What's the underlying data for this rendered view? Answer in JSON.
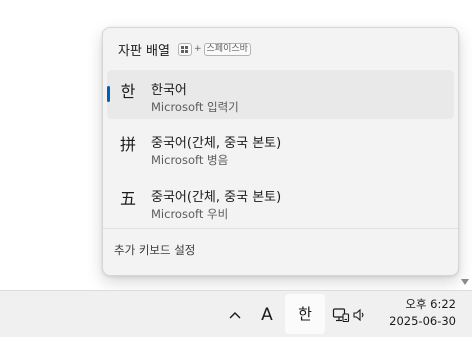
{
  "flyout": {
    "title": "자판 배열",
    "shortcut": {
      "plus": "+",
      "key": "스페이스바"
    },
    "items": [
      {
        "icon": "한",
        "name": "한국어",
        "sub": "Microsoft 입력기",
        "selected": true
      },
      {
        "icon": "拼",
        "name": "중국어(간체, 중국 본토)",
        "sub": "Microsoft 병음",
        "selected": false
      },
      {
        "icon": "五",
        "name": "중국어(간체, 중국 본토)",
        "sub": "Microsoft 우비",
        "selected": false
      }
    ],
    "more_settings": "추가 키보드 설정"
  },
  "taskbar": {
    "input_mode": "A",
    "ime": "한",
    "clock": {
      "time": "오후 6:22",
      "date": "2025-06-30"
    }
  },
  "colors": {
    "accent": "#005fb8",
    "flyout_bg": "#f3f3f3",
    "taskbar_bg": "#f0f0f0"
  }
}
